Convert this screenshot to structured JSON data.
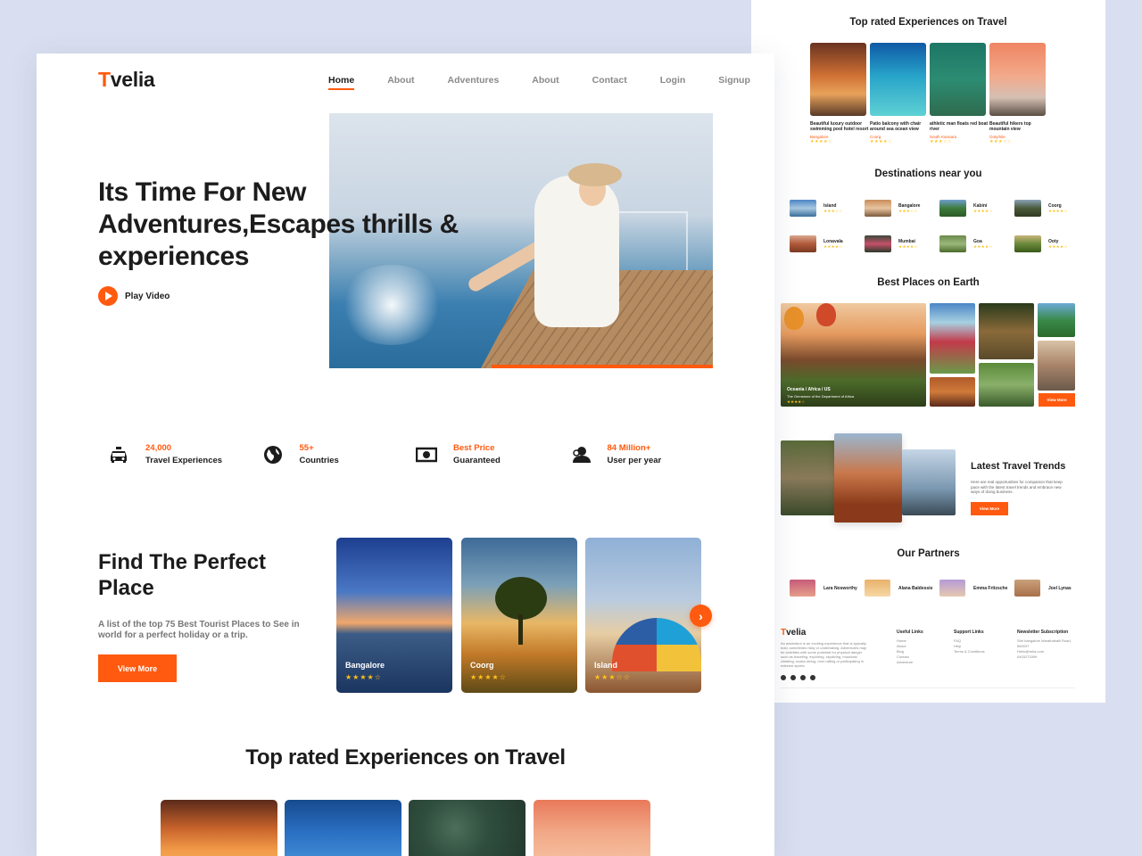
{
  "brand": {
    "first": "T",
    "rest": "velia",
    "accent": "#ff5a0f"
  },
  "nav": [
    "Home",
    "About",
    "Adventures",
    "About",
    "Contact",
    "Login",
    "Signup"
  ],
  "hero": {
    "title": "Its Time For New Adventures,Escapes thrills & experiences",
    "play_label": "Play Video"
  },
  "stats": [
    {
      "icon": "taxi-icon",
      "value": "24,000",
      "label": "Travel Experiences"
    },
    {
      "icon": "globe-icon",
      "value": "55+",
      "label": "Countries"
    },
    {
      "icon": "money-icon",
      "value": "Best Price",
      "label": "Guaranteed"
    },
    {
      "icon": "users-icon",
      "value": "84 Million+",
      "label": "User per year"
    }
  ],
  "find": {
    "title": "Find The Perfect Place",
    "desc": "A list of the top 75 Best Tourist Places to See in world for a perfect holiday or a trip.",
    "button": "View More",
    "cards": [
      {
        "name": "Bangalore",
        "stars": "★★★★☆"
      },
      {
        "name": "Coorg",
        "stars": "★★★★☆"
      },
      {
        "name": "Island",
        "stars": "★★★☆☆"
      }
    ],
    "next_icon": "›"
  },
  "top_rated": {
    "title": "Top rated Experiences on Travel"
  },
  "back": {
    "top_rated_title": "Top rated Experiences on Travel",
    "top_rated_cards": [
      {
        "caption": "Beautiful luxury outdoor swimming pool hotel resort",
        "location": "Bangalore",
        "stars": "★★★★☆"
      },
      {
        "caption": "Patio balcony with chair around sea ocean view",
        "location": "Coorg",
        "stars": "★★★★☆"
      },
      {
        "caption": "athletic man floats red boat river",
        "location": "South Kannara",
        "stars": "★★★☆☆"
      },
      {
        "caption": "Beautiful hikers top mountain view",
        "location": "Ooty/Isle",
        "stars": "★★★☆☆"
      }
    ],
    "near_title": "Destinations near you",
    "near": [
      {
        "name": "Island",
        "stars": "★★★☆☆"
      },
      {
        "name": "Bangalore",
        "stars": "★★★☆☆"
      },
      {
        "name": "Kabini",
        "stars": "★★★★☆"
      },
      {
        "name": "Coorg",
        "stars": "★★★★☆"
      },
      {
        "name": "Lonavala",
        "stars": "★★★★☆"
      },
      {
        "name": "Mumbai",
        "stars": "★★★★☆"
      },
      {
        "name": "Goa",
        "stars": "★★★★☆"
      },
      {
        "name": "Ooty",
        "stars": "★★★★☆"
      }
    ],
    "best_title": "Best Places on Earth",
    "best_main": {
      "caption": "Oceania / Africa / US",
      "sub": "The Gemstone of the Department of Africa",
      "stars": "★★★★☆"
    },
    "best_button": "View More",
    "trends_title": "Latest Travel Trends",
    "trends_desc": "Here are real opportunities for companion that keep pace with the latest travel trends and embrace new ways of doing business.",
    "trends_button": "View More",
    "partners_title": "Our Partners",
    "partners": [
      "Lara Nosworthy",
      "Alana Baldessie",
      "Emma Fritzsche",
      "Joel Lynas"
    ],
    "footer": {
      "about": "An adventure is an exciting experience that is typically bold, sometimes risky or undertaking. Adventures may be activities with some potential for physical danger such as traveling, exploring, skydiving, mountain climbing, scuba diving, river rafting or participating in extreme sports.",
      "useful_title": "Useful Links",
      "useful": [
        "Home",
        "About",
        "Blog",
        "Contact",
        "Adventure"
      ],
      "support_title": "Support Links",
      "support": [
        "FAQ",
        "Help",
        "Terms & Conditions"
      ],
      "news_title": "Newsletter Subscription",
      "news": [
        "Shri bangalore Marathahalli Road, 560037",
        "Hello@velia.com",
        "0403273399"
      ]
    }
  }
}
